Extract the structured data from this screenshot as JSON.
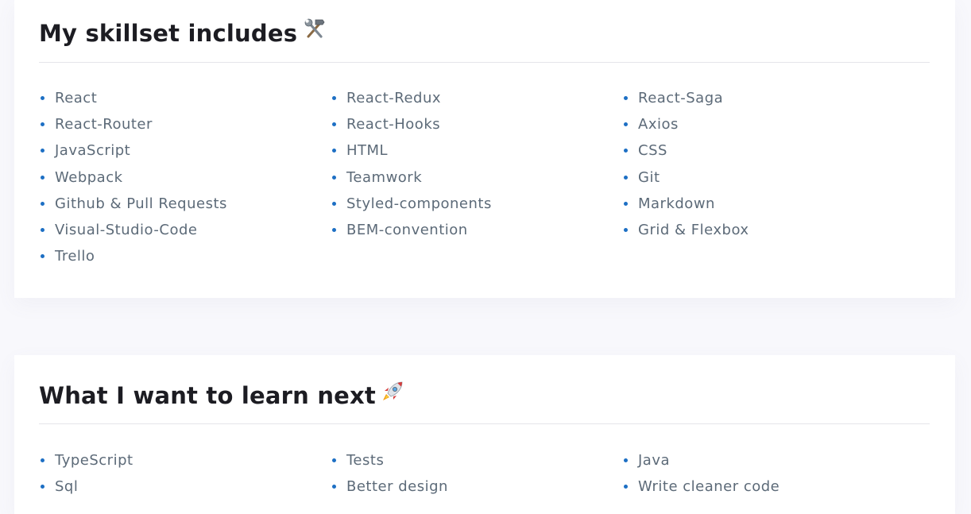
{
  "sections": [
    {
      "title": "My skillset includes",
      "icon": "hammer-and-wrench-icon",
      "items": [
        "React",
        "React-Redux",
        "React-Saga",
        "React-Router",
        "React-Hooks",
        "Axios",
        "JavaScript",
        "HTML",
        "CSS",
        "Webpack",
        "Teamwork",
        "Git",
        "Github & Pull Requests",
        "Styled-components",
        "Markdown",
        "Visual-Studio-Code",
        "BEM-convention",
        "Grid & Flexbox",
        "Trello"
      ]
    },
    {
      "title": "What I want to learn next",
      "icon": "rocket-icon",
      "items": [
        "TypeScript",
        "Tests",
        "Java",
        "Sql",
        "Better design",
        "Write cleaner code"
      ]
    }
  ],
  "colors": {
    "background": "#f8f8fc",
    "card": "#ffffff",
    "title": "#1c1c22",
    "item_text": "#5c6a78",
    "bullet": "#1d6fc4",
    "divider": "#e5e5ea"
  }
}
